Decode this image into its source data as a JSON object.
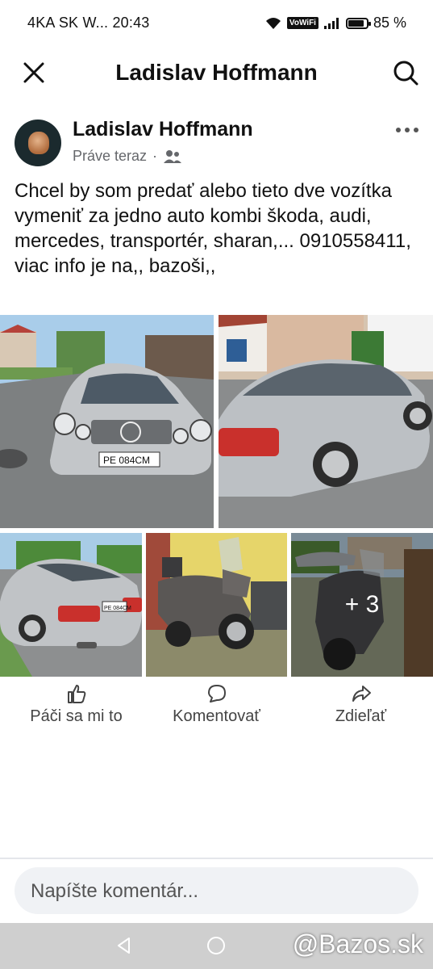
{
  "status_bar": {
    "carrier": "4KA SK W...",
    "time": "20:43",
    "vowifi": "VoWiFi",
    "battery_percent": "85 %",
    "battery_level": 0.85
  },
  "header": {
    "title": "Ladislav Hoffmann",
    "close_icon": "close-icon",
    "search_icon": "search-icon"
  },
  "post": {
    "author": "Ladislav Hoffmann",
    "time": "Práve teraz",
    "separator": "·",
    "audience_icon": "friends-icon",
    "text": "Chcel by som predať alebo tieto dve vozítka vymeniť za jedno auto kombi škoda, audi, mercedes, transportér, sharan,... 0910558411, viac info je na,, bazoši,,",
    "photos": [
      {
        "name": "photo-car-front",
        "plate": "PE 084CM"
      },
      {
        "name": "photo-car-side"
      },
      {
        "name": "photo-car-rear",
        "plate": "PE 084CM"
      },
      {
        "name": "photo-scooter"
      },
      {
        "name": "photo-scooter-2",
        "more_count": "+ 3"
      }
    ]
  },
  "actions": {
    "like": "Páči sa mi to",
    "comment": "Komentovať",
    "share": "Zdieľať"
  },
  "comment_box": {
    "placeholder": "Napíšte komentár..."
  },
  "watermark": "@Bazos.sk",
  "colors": {
    "text_primary": "#111111",
    "text_secondary": "#65676b",
    "input_bg": "#f0f2f5",
    "nav_bg": "#cfcfcf"
  }
}
